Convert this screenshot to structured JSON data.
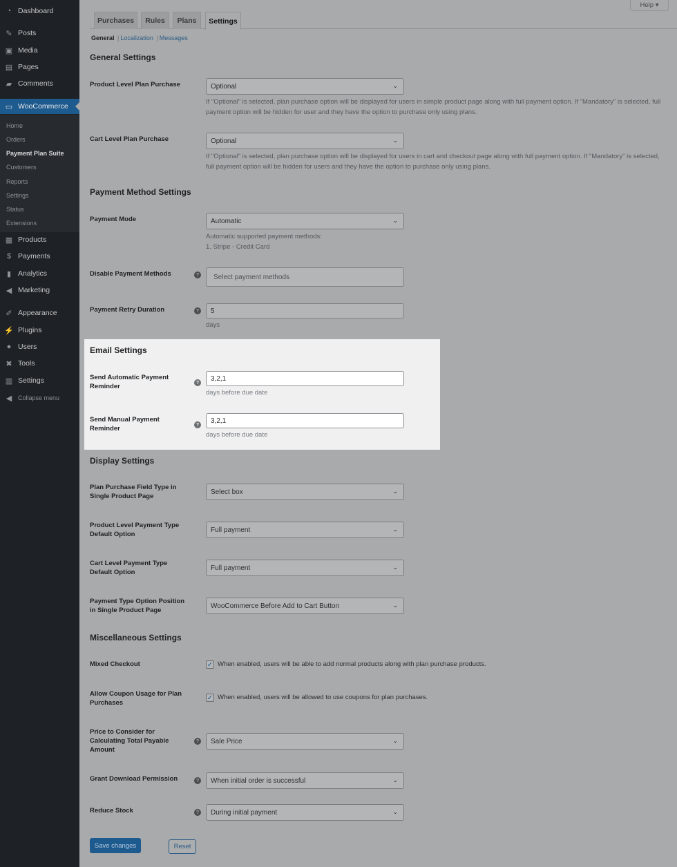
{
  "sidebar": {
    "items": [
      "Dashboard",
      "Posts",
      "Media",
      "Pages",
      "Comments",
      "WooCommerce",
      "Products",
      "Payments",
      "Analytics",
      "Marketing",
      "Appearance",
      "Plugins",
      "Users",
      "Tools",
      "Settings",
      "Collapse menu"
    ],
    "submenu": [
      "Home",
      "Orders",
      "Payment Plan Suite",
      "Customers",
      "Reports",
      "Settings",
      "Status",
      "Extensions"
    ]
  },
  "help": "Help ▾",
  "tabs": [
    "Purchases",
    "Rules",
    "Plans",
    "Settings"
  ],
  "subnav": [
    "General",
    "Localization",
    "Messages"
  ],
  "sections": {
    "general": "General Settings",
    "payment": "Payment Method Settings",
    "email": "Email Settings",
    "display": "Display Settings",
    "misc": "Miscellaneous Settings"
  },
  "fields": {
    "product_level": {
      "label": "Product Level Plan Purchase",
      "value": "Optional",
      "desc": "If \"Optional\" is selected, plan purchase option will be displayed for users in simple product page along with full payment option. If \"Mandatory\" is selected, full payment option will be hidden for user and they have the option to purchase only using plans."
    },
    "cart_level": {
      "label": "Cart Level Plan Purchase",
      "value": "Optional",
      "desc": "If \"Optional\" is selected, plan purchase option will be displayed for users in cart and checkout page along with full payment option. If \"Mandatory\" is selected, full payment option will be hidden for users and they have the option to purchase only using plans."
    },
    "payment_mode": {
      "label": "Payment Mode",
      "value": "Automatic",
      "desc1": "Automatic supported payment methods:",
      "desc2": "1. Stripe - Credit Card"
    },
    "disable_methods": {
      "label": "Disable Payment Methods",
      "placeholder": "Select payment methods"
    },
    "retry": {
      "label": "Payment Retry Duration",
      "value": "5",
      "desc": "days"
    },
    "auto_reminder": {
      "label": "Send Automatic Payment Reminder",
      "value": "3,2,1",
      "desc": "days before due date"
    },
    "manual_reminder": {
      "label": "Send Manual Payment Reminder",
      "value": "3,2,1",
      "desc": "days before due date"
    },
    "field_type": {
      "label": "Plan Purchase Field Type in Single Product Page",
      "value": "Select box"
    },
    "product_default": {
      "label": "Product Level Payment Type Default Option",
      "value": "Full payment"
    },
    "cart_default": {
      "label": "Cart Level Payment Type Default Option",
      "value": "Full payment"
    },
    "position": {
      "label": "Payment Type Option Position in Single Product Page",
      "value": "WooCommerce Before Add to Cart Button"
    },
    "mixed": {
      "label": "Mixed Checkout",
      "checked": true,
      "text": "When enabled, users will be able to add normal products along with plan purchase products."
    },
    "coupon": {
      "label": "Allow Coupon Usage for Plan Purchases",
      "checked": true,
      "text": "When enabled, users will be allowed to use coupons for plan purchases."
    },
    "price": {
      "label": "Price to Consider for Calculating Total Payable Amount",
      "value": "Sale Price"
    },
    "download": {
      "label": "Grant Download Permission",
      "value": "When initial order is successful"
    },
    "stock": {
      "label": "Reduce Stock",
      "value": "During initial payment"
    }
  },
  "buttons": {
    "save": "Save changes",
    "reset": "Reset"
  }
}
